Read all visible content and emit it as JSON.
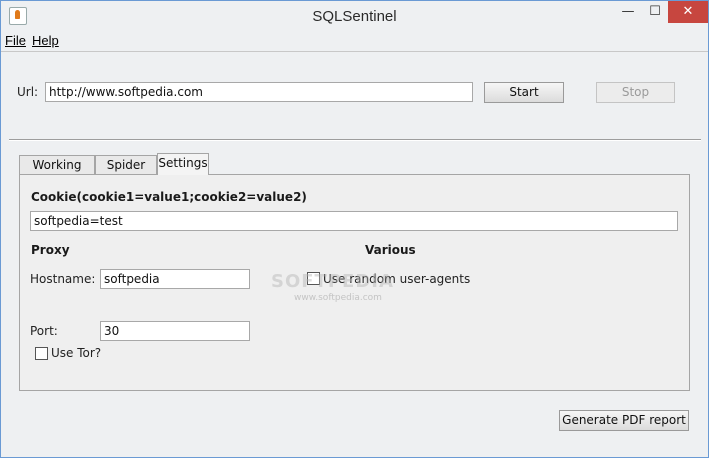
{
  "window": {
    "title": "SQLSentinel",
    "minimize": "—",
    "maximize": "☐",
    "close": "✕"
  },
  "menu": [
    {
      "label": "File"
    },
    {
      "label": "Help"
    }
  ],
  "url": {
    "label": "Url:",
    "value": "http://www.softpedia.com"
  },
  "toolbar": {
    "start_label": "Start",
    "stop_label": "Stop"
  },
  "tabs": [
    {
      "label": "Working Logs"
    },
    {
      "label": "Spider logs"
    },
    {
      "label": "Settings",
      "active": true
    }
  ],
  "settings": {
    "cookie_heading": "Cookie(cookie1=value1;cookie2=value2)",
    "cookie_value": "softpedia=test",
    "proxy_heading": "Proxy",
    "hostname_label": "Hostname:",
    "hostname_value": "softpedia",
    "port_label": "Port:",
    "port_value": "30",
    "use_tor_label": "Use Tor?",
    "use_tor_checked": false,
    "various_heading": "Various",
    "random_ua_label": "Use random user-agents",
    "random_ua_checked": false
  },
  "report_button_label": "Generate PDF report",
  "watermark": {
    "main": "SOFTPEDIA",
    "sub": "www.softpedia.com"
  }
}
